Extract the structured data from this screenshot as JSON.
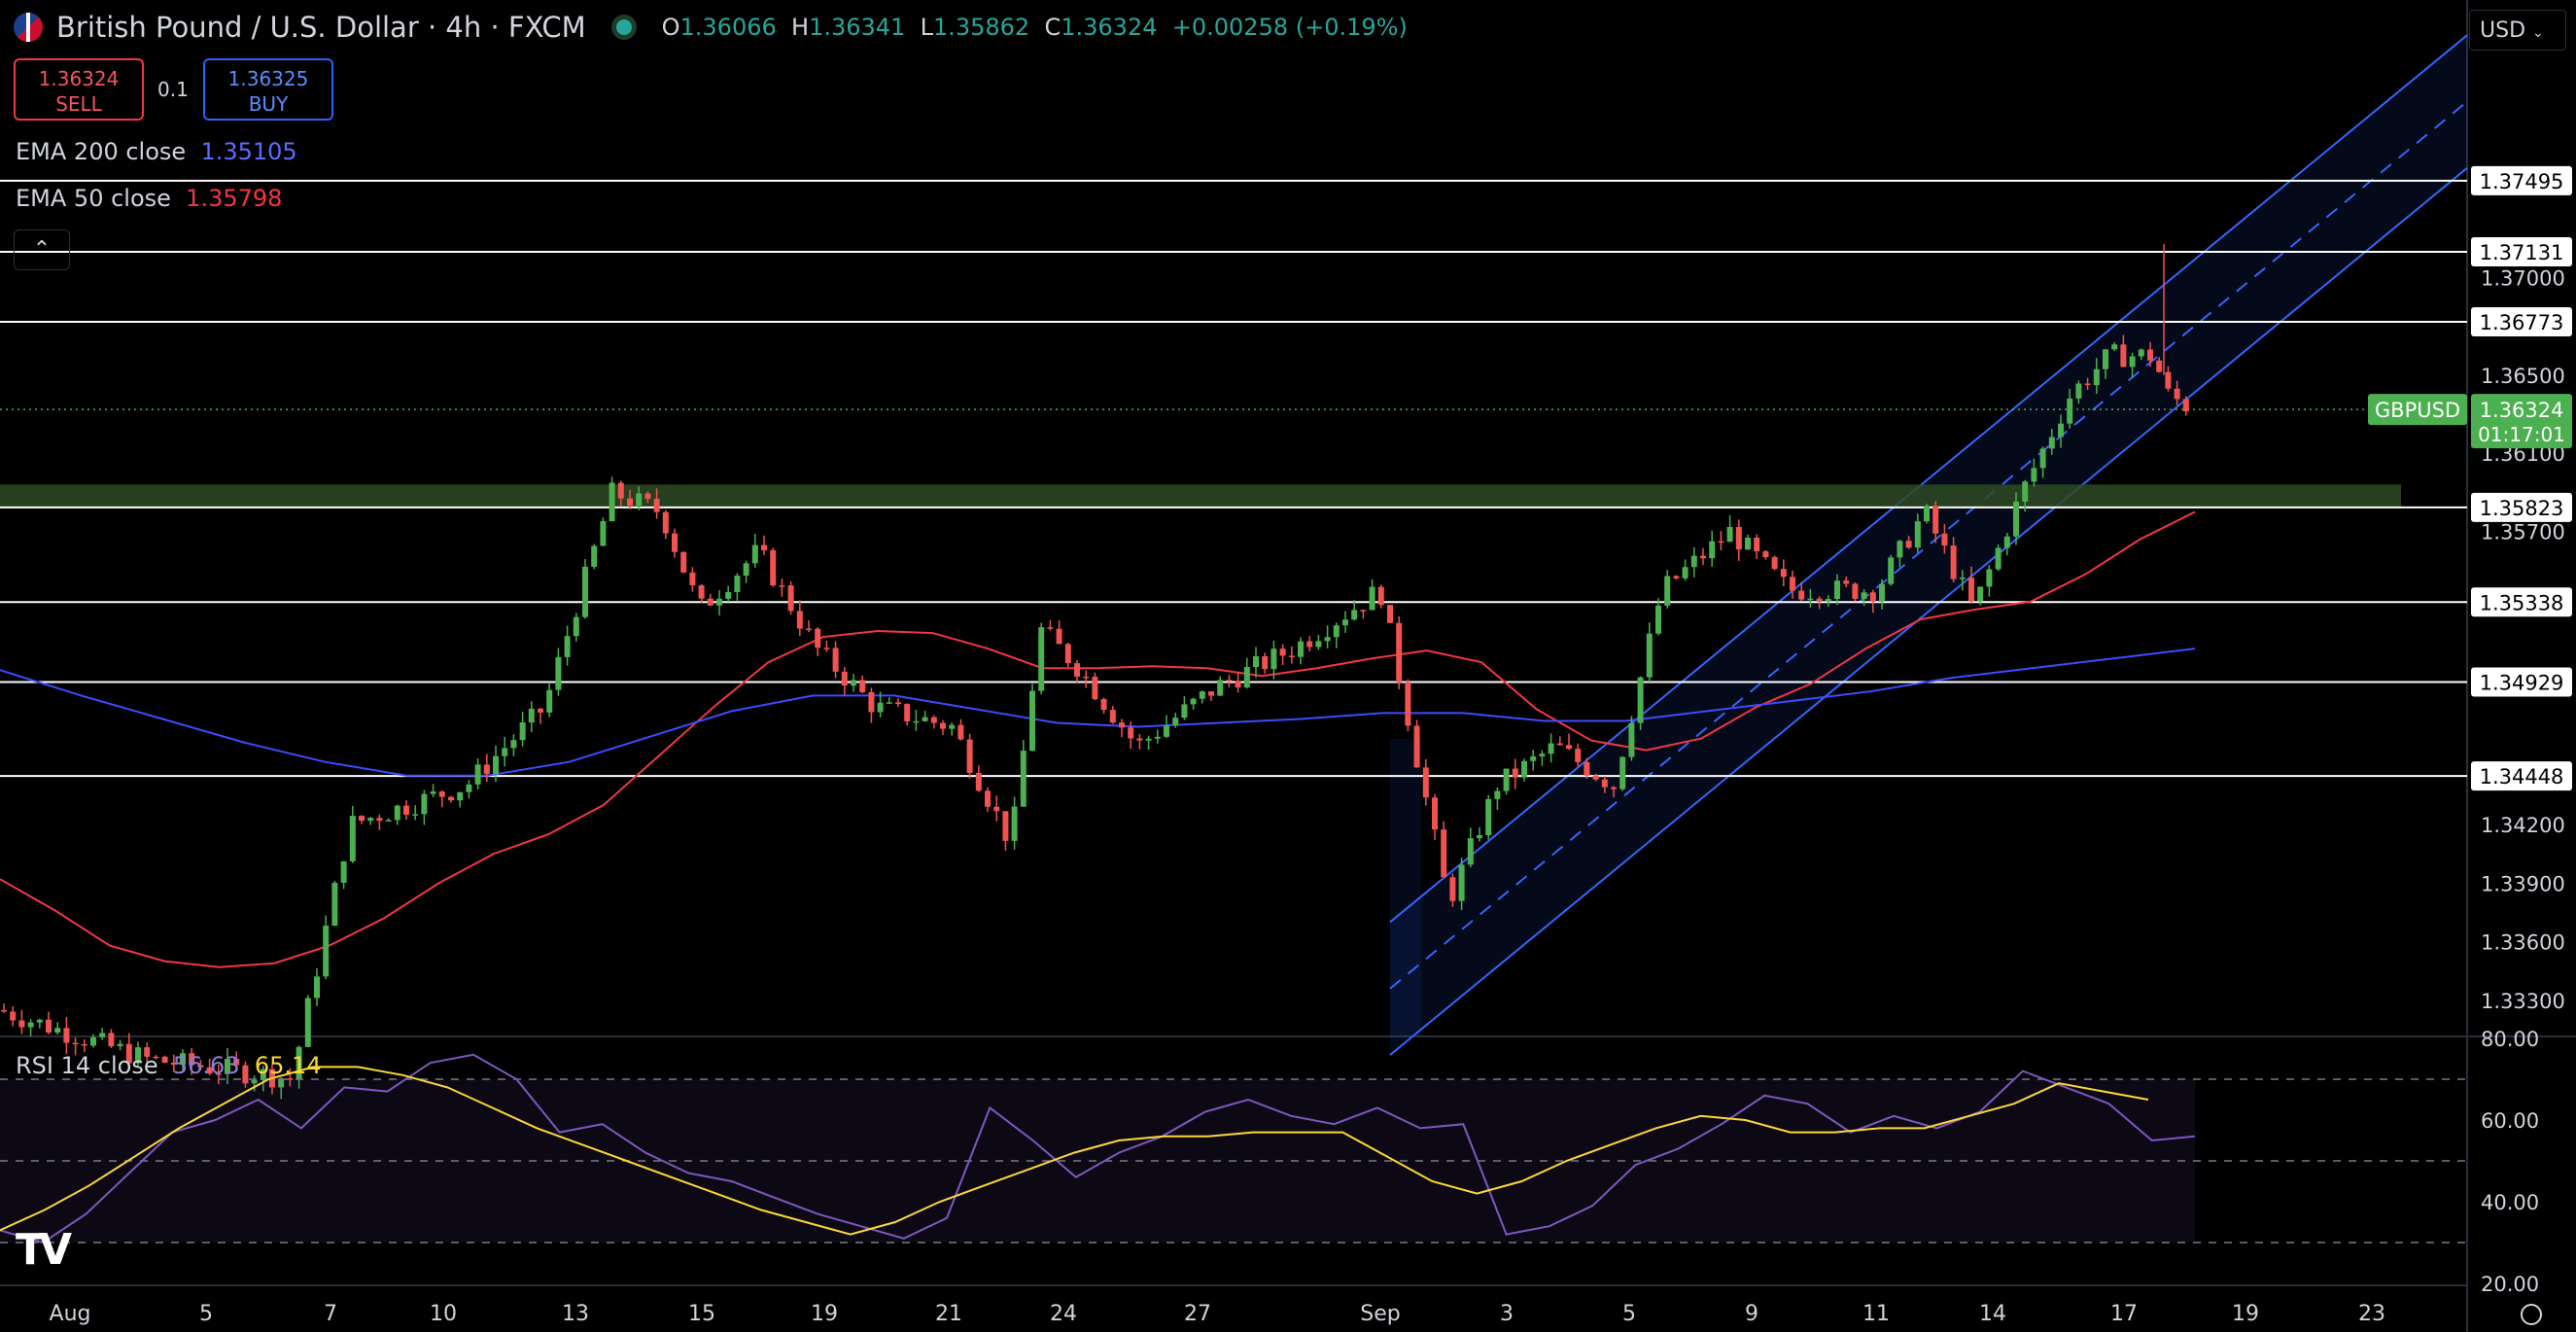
{
  "header": {
    "symbol_title": "British Pound / U.S. Dollar · 4h · FXCM",
    "ohlc": [
      {
        "label": "O",
        "value": "1.36066"
      },
      {
        "label": "H",
        "value": "1.36341"
      },
      {
        "label": "L",
        "value": "1.35862"
      },
      {
        "label": "C",
        "value": "1.36324"
      }
    ],
    "change": "+0.00258 (+0.19%)"
  },
  "trade": {
    "sell_price": "1.36324",
    "sell_label": "SELL",
    "spread": "0.1",
    "buy_price": "1.36325",
    "buy_label": "BUY"
  },
  "indicators": {
    "ema200_label": "EMA 200 close",
    "ema200_value": "1.35105",
    "ema50_label": "EMA 50 close",
    "ema50_value": "1.35798",
    "rsi_label": "RSI 14 close",
    "rsi_value": "56.63",
    "rsi_ma_value": "65.14"
  },
  "currency_selector": "USD",
  "colors": {
    "up": "#4caf50",
    "down": "#f05350",
    "ema50": "#f23645",
    "ema200": "#3d4bff",
    "channel": "#3366ff",
    "rsi": "#7e57c2",
    "rsi_ma": "#fdd835",
    "support_zone": "#2e4a25",
    "last_price": "#4caf50"
  },
  "chart_data": {
    "type": "candlestick",
    "symbol": "GBPUSD",
    "timeframe": "4h",
    "y_price_range": [
      1.3312,
      1.3842
    ],
    "x_tick_labels": [
      "Aug",
      "5",
      "7",
      "10",
      "13",
      "15",
      "19",
      "21",
      "24",
      "27",
      "Sep",
      "3",
      "5",
      "9",
      "11",
      "14",
      "17",
      "19",
      "23"
    ],
    "y_tick_labels": [
      "1.37000",
      "1.36500",
      "1.36100",
      "1.35700",
      "1.34200",
      "1.33900",
      "1.33600",
      "1.33300"
    ],
    "horizontal_levels": [
      "1.37495",
      "1.37131",
      "1.36773",
      "1.35823",
      "1.35338",
      "1.34929",
      "1.34448"
    ],
    "support_zone": [
      1.3582,
      1.3594
    ],
    "last_price": {
      "label": "GBPUSD",
      "value": "1.36324",
      "countdown": "01:17:01"
    },
    "ema50_close": [
      1.3392,
      1.3376,
      1.3358,
      1.335,
      1.3347,
      1.3349,
      1.3358,
      1.3372,
      1.339,
      1.3405,
      1.3415,
      1.343,
      1.3455,
      1.348,
      1.3503,
      1.3516,
      1.3519,
      1.3518,
      1.351,
      1.35,
      1.35,
      1.3501,
      1.35,
      1.3496,
      1.35,
      1.3505,
      1.3509,
      1.3503,
      1.3479,
      1.3463,
      1.3458,
      1.3464,
      1.348,
      1.3492,
      1.351,
      1.3525,
      1.353,
      1.3534,
      1.3548,
      1.3566,
      1.358
    ],
    "ema200_close": [
      1.3499,
      1.3486,
      1.3474,
      1.3462,
      1.3452,
      1.3445,
      1.3445,
      1.3452,
      1.3465,
      1.3478,
      1.3486,
      1.3486,
      1.3479,
      1.3472,
      1.347,
      1.3472,
      1.3474,
      1.3477,
      1.3477,
      1.3473,
      1.3473,
      1.3478,
      1.3483,
      1.3488,
      1.3495,
      1.35,
      1.3505,
      1.351
    ],
    "rsi": {
      "range": [
        20,
        80
      ],
      "levels": [
        30,
        50,
        70
      ],
      "tick_labels": [
        "80.00",
        "60.00",
        "40.00",
        "20.00"
      ],
      "rsi_values": [
        33,
        30,
        37,
        47,
        57,
        60,
        65,
        58,
        68,
        67,
        74,
        76,
        70,
        57,
        59,
        52,
        47,
        45,
        41,
        37,
        34,
        31,
        36,
        63,
        55,
        46,
        52,
        56,
        62,
        65,
        61,
        59,
        63,
        58,
        59,
        32,
        34,
        39,
        49,
        53,
        59,
        66,
        64,
        57,
        61,
        58,
        62,
        72,
        68,
        64,
        55,
        56
      ],
      "ma_values": [
        33,
        38,
        44,
        51,
        58,
        64,
        70,
        73,
        73,
        71,
        68,
        63,
        58,
        54,
        50,
        46,
        42,
        38,
        35,
        32,
        35,
        40,
        44,
        48,
        52,
        55,
        56,
        56,
        57,
        57,
        57,
        51,
        45,
        42,
        45,
        50,
        54,
        58,
        61,
        60,
        57,
        57,
        58,
        58,
        61,
        64,
        69,
        67,
        65
      ]
    }
  }
}
